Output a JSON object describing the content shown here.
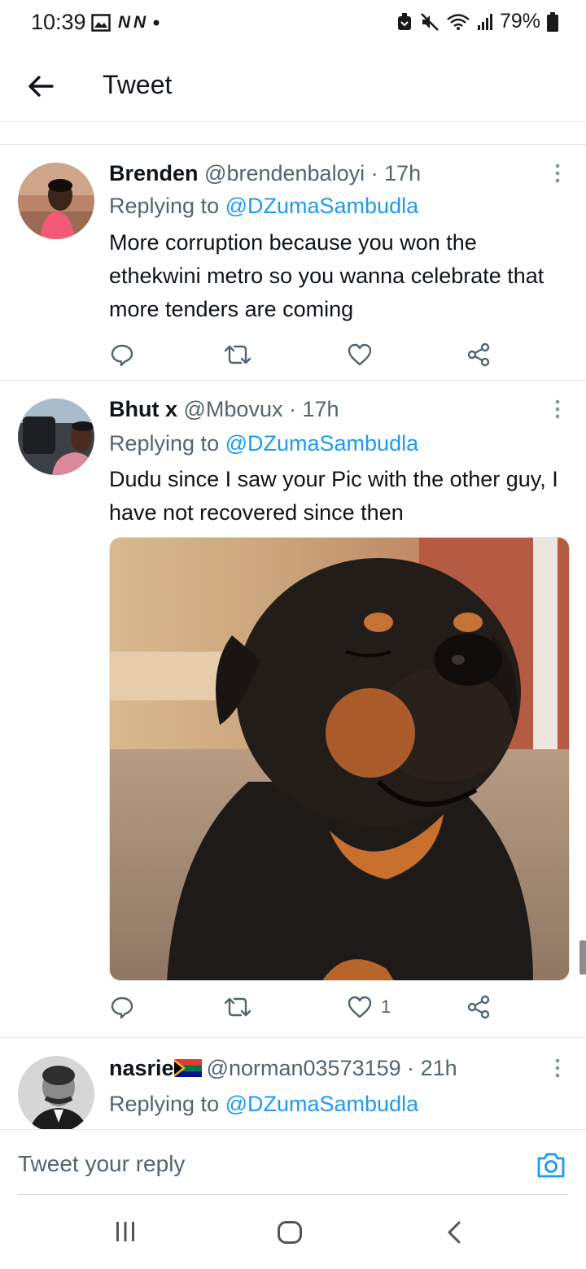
{
  "status_bar": {
    "time": "10:39",
    "notif_letters": "N N",
    "battery": "79%"
  },
  "header": {
    "title": "Tweet"
  },
  "tweets": [
    {
      "name": "Brenden",
      "handle": "@brendenbaloyi · 17h",
      "replying_prefix": "Replying to ",
      "replying_to": "@DZumaSambudla",
      "body": "More corruption because you won the ethekwini metro so you wanna celebrate that more tenders are coming",
      "likes": ""
    },
    {
      "name": "Bhut x",
      "handle": "@Mbovux · 17h",
      "replying_prefix": "Replying to ",
      "replying_to": "@DZumaSambudla",
      "body": "Dudu since I saw your Pic with the other guy, I have not recovered since then",
      "likes": "1"
    },
    {
      "name": "nasrie",
      "handle": "@norman03573159 · 21h",
      "replying_prefix": "Replying to ",
      "replying_to": "@DZumaSambudla"
    }
  ],
  "reply_bar": {
    "placeholder": "Tweet your reply"
  },
  "icons": {
    "back": "arrow-left-icon",
    "reply": "comment-icon",
    "retweet": "retweet-icon",
    "like": "heart-icon",
    "share": "share-icon",
    "more": "more-vertical-icon",
    "camera": "camera-icon",
    "flag": "south-africa-flag-icon"
  },
  "colors": {
    "accent": "#1d9bf0",
    "secondary_text": "#536471",
    "primary_text": "#0f1419"
  }
}
